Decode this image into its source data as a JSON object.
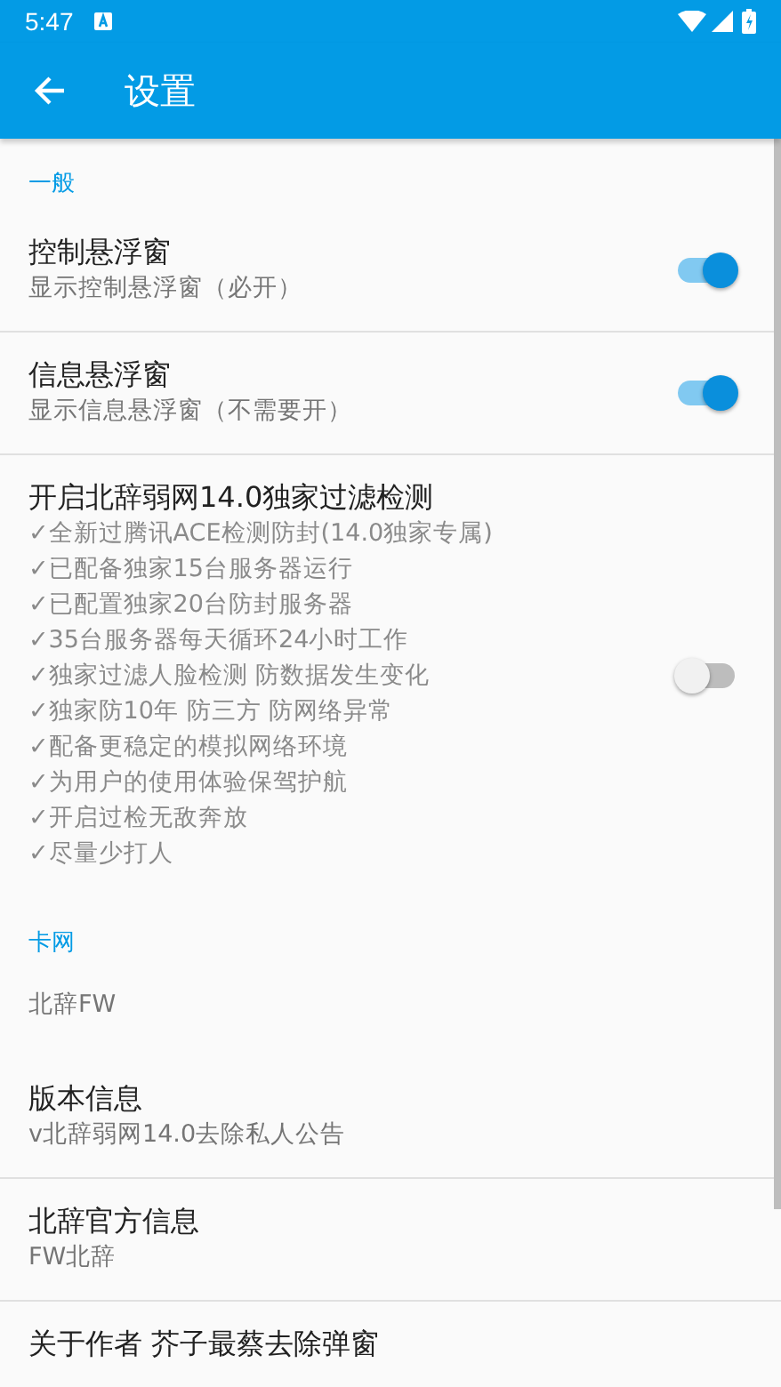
{
  "status_bar": {
    "time": "5:47"
  },
  "app_bar": {
    "title": "设置"
  },
  "items": [
    {
      "kind": "category",
      "title": "一般"
    },
    {
      "kind": "switch",
      "title": "控制悬浮窗",
      "summary": "显示控制悬浮窗（必开）",
      "on": true,
      "divider": true
    },
    {
      "kind": "switch",
      "title": "信息悬浮窗",
      "summary": "显示信息悬浮窗（不需要开）",
      "on": true,
      "divider": true
    },
    {
      "kind": "switch",
      "title": "开启北辞弱网14.0独家过滤检测",
      "summary_lines": [
        "✓全新过腾讯ACE检测防封(14.0独家专属)",
        "✓已配备独家15台服务器运行",
        "✓已配置独家20台防封服务器",
        "✓35台服务器每天循环24小时工作",
        "✓独家过滤人脸检测 防数据发生变化",
        "✓独家防10年 防三方 防网络异常",
        "✓配备更稳定的模拟网络环境",
        "✓为用户的使用体验保驾护航",
        "✓开启过检无敌奔放",
        "✓尽量少打人"
      ],
      "on": false,
      "divider": false
    },
    {
      "kind": "category",
      "title": "卡网"
    },
    {
      "kind": "plain",
      "summary": "北辞FW",
      "divider": false
    },
    {
      "kind": "plain",
      "title": "版本信息",
      "summary": "v北辞弱网14.0去除私人公告",
      "divider": true
    },
    {
      "kind": "plain",
      "title": "北辞官方信息",
      "summary": "FW北辞",
      "divider": true
    },
    {
      "kind": "plain",
      "title": "关于作者 芥子最蔡去除弹窗"
    }
  ]
}
